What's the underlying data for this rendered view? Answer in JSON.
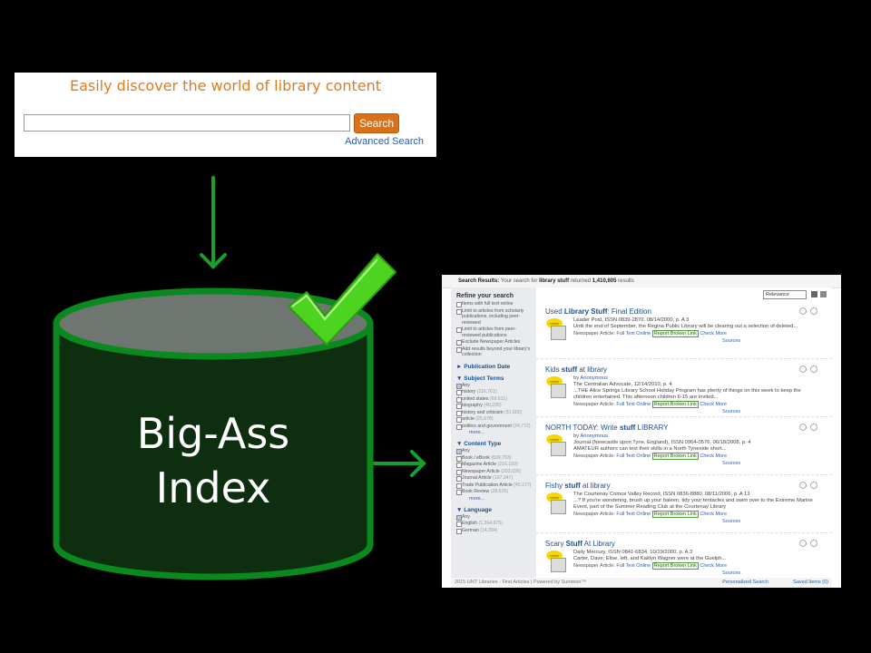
{
  "search_panel": {
    "tagline": "Easily discover the world of library content",
    "search_value": "",
    "search_button": "Search",
    "advanced_link": "Advanced Search"
  },
  "index_db": {
    "label_line1": "Big-Ass",
    "label_line2": "Index",
    "fill_color": "#0e2e10",
    "stroke_color": "#0a8a1e",
    "check_color": "#4cd421",
    "arrow_color": "#16a02c"
  },
  "results_page": {
    "summary_prefix": "Search Results:",
    "summary_mid": "Your search for",
    "summary_query": "library stuff",
    "summary_returned": "returned",
    "summary_count": "1,410,605",
    "summary_suffix": "results",
    "sort_value": "Relevance",
    "refine_title": "Refine your search",
    "refine_options": [
      "Items with full text online",
      "Limit to articles from scholarly publications, including peer-reviewed",
      "Limit to articles from peer-reviewed publications",
      "Exclude Newspaper Articles",
      "Add results beyond your library's collection"
    ],
    "facets": [
      {
        "title": "Publication Date",
        "items": []
      },
      {
        "title": "Subject Terms",
        "items": [
          {
            "label": "Any",
            "count": "",
            "checked": true
          },
          {
            "label": "history",
            "count": "(116,761)",
            "checked": false
          },
          {
            "label": "united states",
            "count": "(69,611)",
            "checked": false
          },
          {
            "label": "biography",
            "count": "(40,235)",
            "checked": false
          },
          {
            "label": "history and criticism",
            "count": "(31,602)",
            "checked": false
          },
          {
            "label": "article",
            "count": "(25,678)",
            "checked": false
          },
          {
            "label": "politics and government",
            "count": "(24,772)",
            "checked": false
          }
        ],
        "more": "more..."
      },
      {
        "title": "Content Type",
        "items": [
          {
            "label": "Any",
            "count": "",
            "checked": true
          },
          {
            "label": "Book / eBook",
            "count": "(609,703)",
            "checked": false
          },
          {
            "label": "Magazine Article",
            "count": "(216,193)",
            "checked": false
          },
          {
            "label": "Newspaper Article",
            "count": "(203,026)",
            "checked": false
          },
          {
            "label": "Journal Article",
            "count": "(107,347)",
            "checked": false
          },
          {
            "label": "Trade Publication Article",
            "count": "(45,177)",
            "checked": false
          },
          {
            "label": "Book Review",
            "count": "(28,626)",
            "checked": false
          }
        ],
        "more": "more..."
      },
      {
        "title": "Language",
        "items": [
          {
            "label": "Any",
            "count": "",
            "checked": true
          },
          {
            "label": "English",
            "count": "(1,364,675)",
            "checked": false
          },
          {
            "label": "German",
            "count": "(14,394)",
            "checked": false
          }
        ]
      }
    ],
    "results": [
      {
        "title_pre": "Used ",
        "title_bold": "Library Stuff",
        "title_post": ": Final Edition",
        "by": "",
        "source": "Leader Post, ISSN 0839-2870, 08/14/2000, p. A 3",
        "snippet": "Until the end of September, the Regina Public Library will be clearing out a selection of deleted...",
        "type": "Newspaper Article:",
        "full_text": "Full Text Online",
        "report": "Report Broken Link",
        "check": "Check More",
        "sources": "Sources"
      },
      {
        "title_pre": "Kids ",
        "title_bold": "stuff",
        "title_post": " at library",
        "by": "Anonymous",
        "source": "The Centralian Advocate, 12/14/2010, p. 4",
        "snippet": "...THE Alice Springs Library School Holiday Program has plenty of things on this week to keep the children entertained. This afternoon children 6-15 are invited...",
        "type": "Newspaper Article:",
        "full_text": "Full Text Online",
        "report": "Report Broken Link",
        "check": "Check More",
        "sources": "Sources"
      },
      {
        "title_pre": "NORTH TODAY: Write ",
        "title_bold": "stuff",
        "title_post": " LIBRARY",
        "by": "Anonymous",
        "source": "Journal (Newcastle upon Tyne, England), ISSN 0964-0576, 06/18/2008, p. 4",
        "snippet": "AMATEUR authors can test their skills in a North Tyneside short...",
        "type": "Newspaper Article:",
        "full_text": "Full Text Online",
        "report": "Report Broken Link",
        "check": "Check More",
        "sources": "Sources"
      },
      {
        "title_pre": "Fishy ",
        "title_bold": "stuff",
        "title_post": " at library",
        "by": "",
        "source": "The Courtenay Comox Valley Record, ISSN 0836-8880, 08/11/2006, p. A 13",
        "snippet": "...? If you're wondering, brush up your baleen, tidy your tentacles and swim over to the Extreme Marine Event, part of the Summer Reading Club at the Courtenay Library",
        "type": "Newspaper Article:",
        "full_text": "Full Text Online",
        "report": "Report Broken Link",
        "check": "Check More",
        "sources": "Sources"
      },
      {
        "title_pre": "Scary ",
        "title_bold": "Stuff",
        "title_post": " At Library",
        "by": "",
        "source": "Daily Mercury, ISSN 0841-6834, 10/19/2000, p. A 3",
        "snippet": "Carter, Dave; Elise, left, and Kaitlyn Wagner were at the Guelph...",
        "type": "Newspaper Article:",
        "full_text": "Full Text Online",
        "report": "Report Broken Link",
        "check": "Check More",
        "sources": "Sources"
      }
    ],
    "footer_left": "2015 UNT Libraries - Find Articles  |  Powered by Summon™",
    "footer_mid": "Personalized Search",
    "footer_right": "Saved Items (0)"
  }
}
